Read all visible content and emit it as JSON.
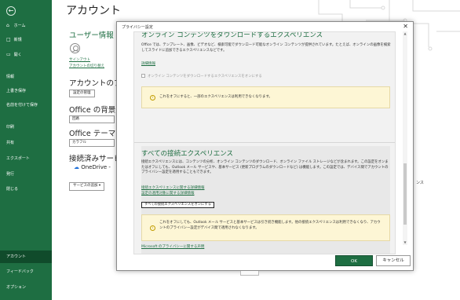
{
  "backstage": {
    "page_title": "アカウント",
    "back_icon": "←",
    "sidebar_top": [
      {
        "icon": "⌂",
        "label": "ホーム"
      },
      {
        "icon": "□",
        "label": "新規"
      },
      {
        "icon": "▭",
        "label": "開く"
      }
    ],
    "sidebar_mid": [
      {
        "label": "情報"
      },
      {
        "label": "上書き保存"
      },
      {
        "label": "名前を付けて保存"
      },
      {
        "label": "印刷"
      },
      {
        "label": "共有"
      },
      {
        "label": "エクスポート"
      },
      {
        "label": "発行"
      },
      {
        "label": "閉じる"
      }
    ],
    "sidebar_bottom": [
      {
        "label": "アカウント",
        "active": true
      },
      {
        "label": "フィードバック"
      },
      {
        "label": "オプション"
      }
    ],
    "user_info_heading": "ユーザー情報",
    "sign_out": "サインアウト",
    "switch_account": "アカウントの切り替え",
    "privacy_heading": "アカウントのプライ",
    "manage_settings": "設定の管理",
    "background_heading": "Office の背景:",
    "background_value": "回路",
    "theme_heading": "Office テーマ",
    "theme_value": "カラフル",
    "connected_services_heading": "接続済みサービ",
    "onedrive_label": "OneDrive - ",
    "add_service_button": "サービスの追加 ▾",
    "right_text": "ンス",
    "cloud_icon": "cloud-icon"
  },
  "dialog": {
    "title": "プライバシー設定",
    "close": "✕",
    "section1_heading": "オンライン コンテンツをダウンロードするエクスペリエンス",
    "section1_desc": "Office では、テンプレート、画像、ビデオなど、検索可能でダウンロード可能なオンライン コンテンツが提供されています。たとえば、オンラインの画像を検索してスライドに追加できるエクスペリエンスなどです。",
    "section1_link": "詳細情報",
    "section1_checkbox": "オンライン コンテンツをダウンロードするエクスペリエンスをオンにする",
    "section1_warning": "これをオフにすると、一部のエクスペリエンスは利用できなくなります。",
    "section2_heading": "すべての接続エクスペリエンス",
    "section2_desc": "接続エクスペリエンスには、コンテンツの分析、オンライン コンテンツのダウンロード、オンライン ファイル ストレージなどが含まれます。この設定をオンまたはオフにしても、Outlook メール サービスや、基本サービス (更新プログラムのダウンロードなど) は機能します。この設定では、デバイス間でアカウントのプライバシー設定を適用することもできます。",
    "section2_link1": "接続エクスペリエンスに関する詳細情報",
    "section2_link2": "設定の適用対象に関する詳細情報",
    "section2_toggle_button": "すべての接続エクスペリエンスをオンにする",
    "section2_warning": "これをオフにしても、Outlook メール サービスと基本サービスは引き続き機能します。他の接続エクスペリエンスは利用できなくなり、アカウントのプライバシー設定がデバイス間で適用されなくなります。",
    "privacy_statement_link": "Microsoft のプライバシーに関する声明",
    "ok_button": "OK",
    "cancel_button": "キャンセル"
  },
  "colors": {
    "excel_green": "#1e6e42",
    "sidebar_active": "#104b2b",
    "warning_bg": "#fdf6d5"
  }
}
